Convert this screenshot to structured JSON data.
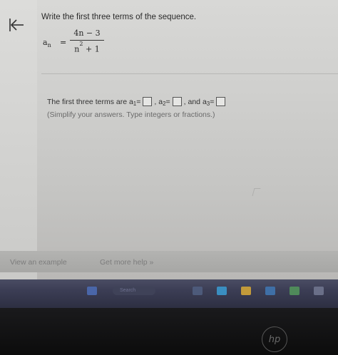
{
  "question": {
    "prompt": "Write the first three terms of the sequence.",
    "formula": {
      "lhs": "a",
      "lhs_sub": "n",
      "equals": "=",
      "numerator": "4n − 3",
      "den_base": "n",
      "den_exp": "2",
      "den_rest": " + 1"
    }
  },
  "answer": {
    "intro": "The first three terms are a",
    "sub1": "1",
    "eq1": " =",
    "sep1": ",  a",
    "sub2": "2",
    "eq2": " =",
    "sep2": ",  and a",
    "sub3": "3",
    "eq3": " =",
    "hint": "(Simplify your answers. Type integers or fractions.)"
  },
  "footer": {
    "example_link": "View an example",
    "help_link": "Get more help »"
  },
  "taskbar": {
    "search_placeholder": "Search"
  },
  "bezel": {
    "logo": "hp"
  }
}
